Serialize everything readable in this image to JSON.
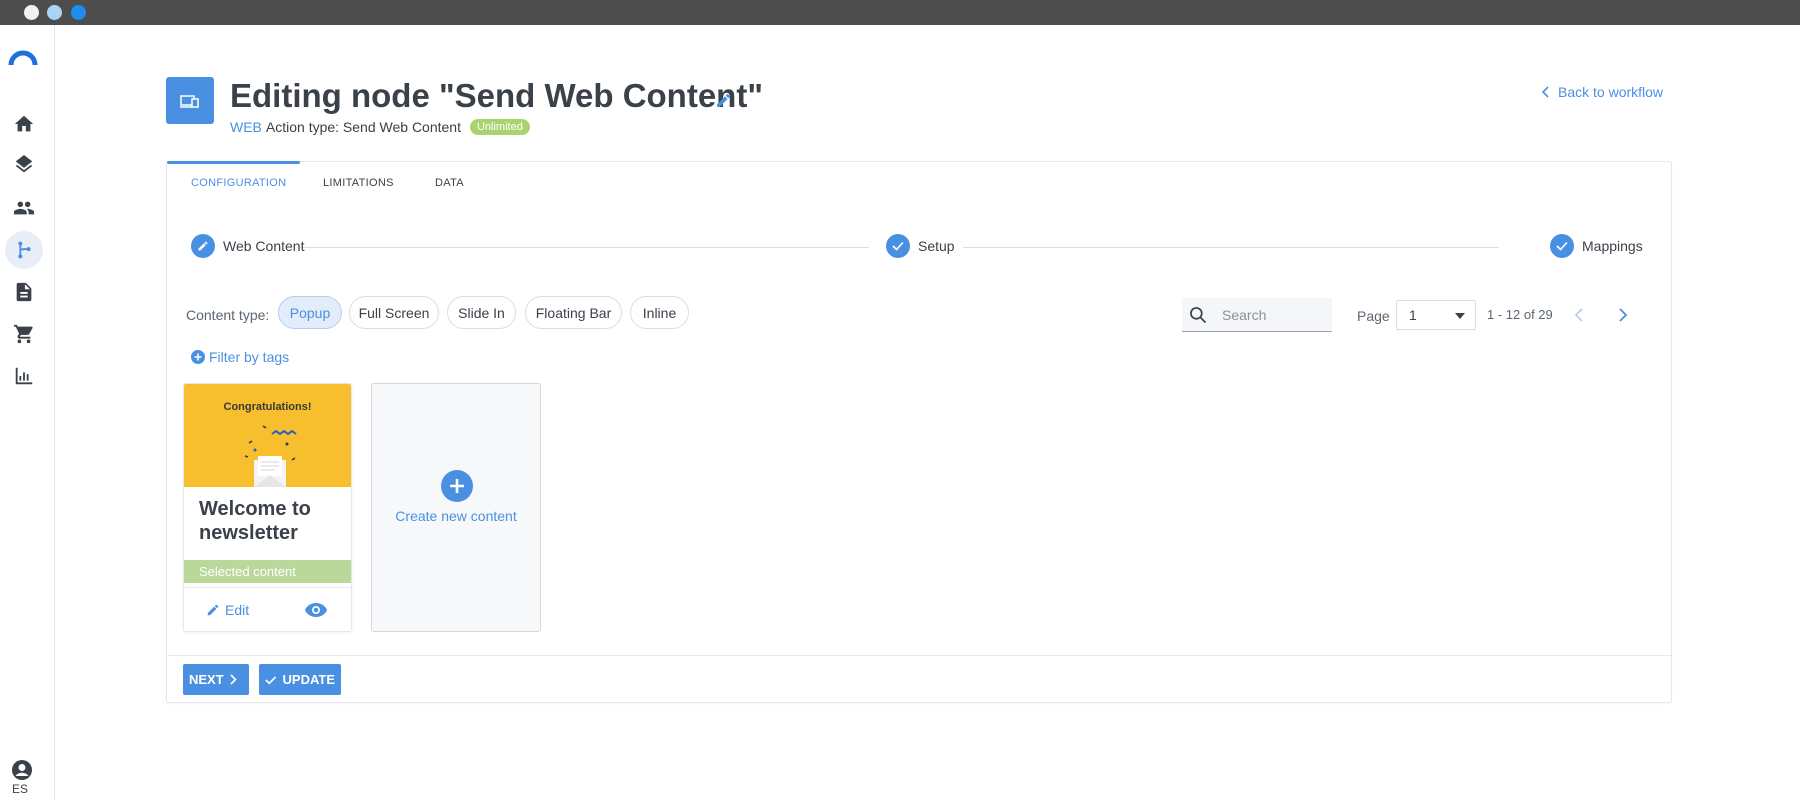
{
  "header": {
    "title": "Editing node \"Send Web Content\"",
    "channel": "WEB",
    "action_type": "Action type: Send Web Content",
    "badge": "Unlimited",
    "back_link": "Back to workflow"
  },
  "tabs": [
    "CONFIGURATION",
    "LIMITATIONS",
    "DATA"
  ],
  "steps": [
    "Web Content",
    "Setup",
    "Mappings"
  ],
  "content_type": {
    "label": "Content type:",
    "options": [
      "Popup",
      "Full Screen",
      "Slide In",
      "Floating Bar",
      "Inline"
    ],
    "selected": "Popup"
  },
  "search": {
    "placeholder": "Search"
  },
  "pagination": {
    "label": "Page",
    "current": "1",
    "range": "1 - 12 of 29"
  },
  "filter": {
    "label": "Filter by tags"
  },
  "content_cards": [
    {
      "thumbnail_text": "Congratulations!",
      "title": "Welcome to newsletter",
      "status": "Selected content",
      "edit_label": "Edit"
    }
  ],
  "create_card": {
    "label": "Create new content"
  },
  "buttons": {
    "next": "NEXT",
    "update": "UPDATE"
  },
  "user": {
    "language": "ES"
  },
  "colors": {
    "accent": "#4a90e2",
    "badge": "#a8d46f",
    "selected": "#b9d89a",
    "thumb": "#f7be2e"
  },
  "icons": {
    "sidebar": [
      "home-icon",
      "layers-icon",
      "people-icon",
      "workflow-icon",
      "document-icon",
      "cart-icon",
      "bar-chart-icon"
    ]
  }
}
